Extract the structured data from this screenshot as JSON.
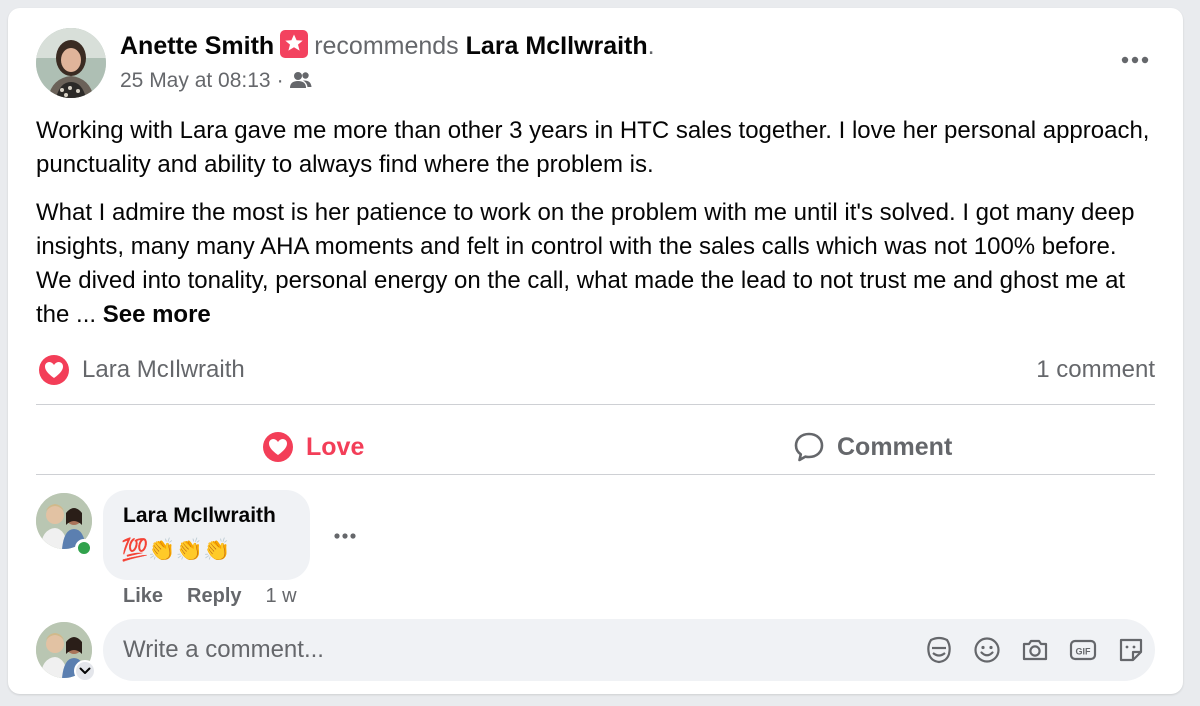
{
  "post": {
    "author": "Anette Smith",
    "verb": "recommends",
    "target": "Lara McIlwraith",
    "period": ".",
    "timestamp": "25 May at 08:13",
    "separator": "·",
    "audience_icon": "friends-icon",
    "paragraphs": [
      "Working with Lara gave me more than other 3 years in HTC sales together. I love her personal approach, punctuality and ability to always find where the problem is.",
      "What I admire the most is her patience to work on the problem with me until it's solved.  I got many deep insights, many many AHA moments and felt in control with the sales calls which was not 100% before. We dived into tonality, personal energy on the call, what made the lead to not trust me and ghost me at the ..."
    ],
    "see_more": "See more"
  },
  "reactions": {
    "icon": "heart-reaction-icon",
    "names": "Lara McIlwraith",
    "comment_count": "1 comment"
  },
  "actions": {
    "love": "Love",
    "comment": "Comment"
  },
  "comment": {
    "author": "Lara McIlwraith",
    "text": "💯👏👏👏",
    "like": "Like",
    "reply": "Reply",
    "time": "1 w"
  },
  "composer": {
    "placeholder": "Write a comment..."
  },
  "colors": {
    "love": "#f33e58",
    "muted": "#65676b",
    "bubble": "#f0f2f5",
    "online": "#31a24c"
  }
}
